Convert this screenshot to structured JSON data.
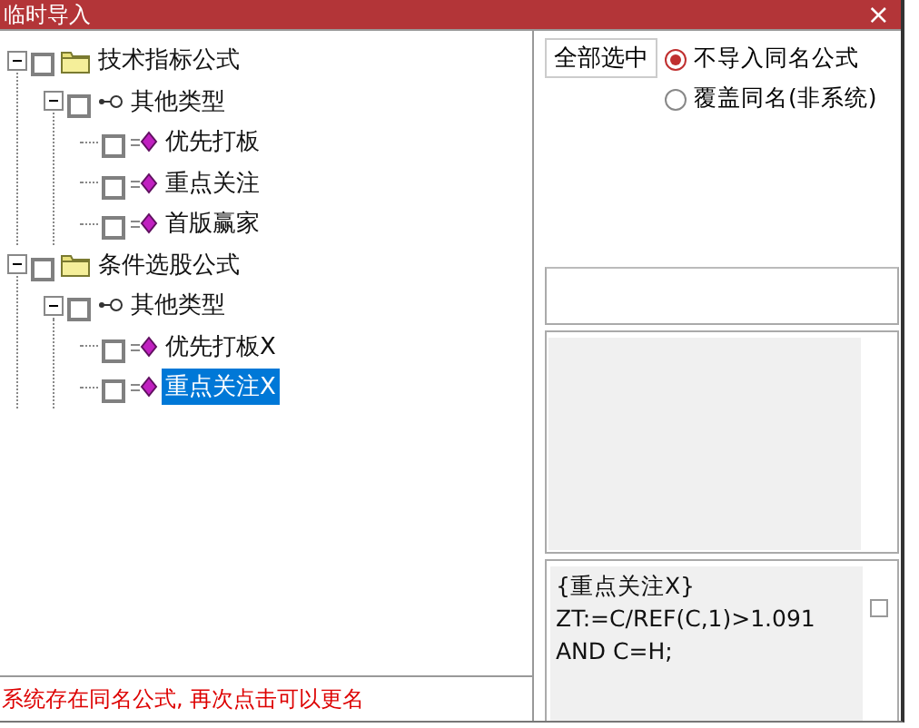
{
  "window": {
    "title": "临时导入",
    "close": "×"
  },
  "tree": [
    {
      "label": "技术指标公式",
      "kind": "folder",
      "expanded": true,
      "checked": false,
      "selected": false,
      "children": [
        {
          "label": "其他类型",
          "kind": "type",
          "expanded": true,
          "checked": false,
          "selected": false,
          "children": [
            {
              "label": "优先打板",
              "kind": "formula",
              "checked": false,
              "selected": false
            },
            {
              "label": "重点关注",
              "kind": "formula",
              "checked": false,
              "selected": false
            },
            {
              "label": "首版赢家",
              "kind": "formula",
              "checked": false,
              "selected": false
            }
          ]
        }
      ]
    },
    {
      "label": "条件选股公式",
      "kind": "folder",
      "expanded": true,
      "checked": false,
      "selected": false,
      "children": [
        {
          "label": "其他类型",
          "kind": "type",
          "expanded": true,
          "checked": false,
          "selected": false,
          "children": [
            {
              "label": "优先打板X",
              "kind": "formula",
              "checked": false,
              "selected": false
            },
            {
              "label": "重点关注X",
              "kind": "formula",
              "checked": false,
              "selected": true
            }
          ]
        }
      ]
    }
  ],
  "select_all_button": "全部选中",
  "options": [
    {
      "label": "不导入同名公式",
      "selected": true
    },
    {
      "label": "覆盖同名(非系统)",
      "selected": false
    }
  ],
  "code_box": {
    "lines": [
      "{重点关注X}",
      "ZT:=C/REF(C,1)>1.091",
      "AND C=H;"
    ],
    "checked": false
  },
  "status": "系统存在同名公式, 再次点击可以更名"
}
